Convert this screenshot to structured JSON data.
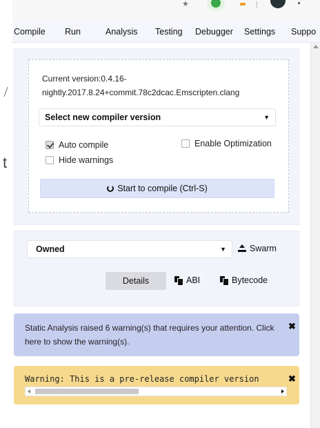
{
  "browser": {
    "icons": [
      "star-icon",
      "extension-green-icon",
      "extension-orange-icon",
      "profile-avatar",
      "menu-dots-icon"
    ]
  },
  "tabs": [
    "Compile",
    "Run",
    "Analysis",
    "Testing",
    "Debugger",
    "Settings",
    "Suppo"
  ],
  "compile": {
    "version_label": "Current version:0.4.16-nightly.2017.8.24+commit.78c2dcac.Emscripten.clang",
    "select_version": "Select new compiler version",
    "auto_compile_label": "Auto compile",
    "auto_compile_checked": true,
    "enable_optimization_label": "Enable Optimization",
    "enable_optimization_checked": false,
    "hide_warnings_label": "Hide warnings",
    "hide_warnings_checked": false,
    "compile_button": "Start to compile (Ctrl-S)"
  },
  "contract": {
    "selected": "Owned",
    "swarm_label": "Swarm",
    "details_label": "Details",
    "abi_label": "ABI",
    "bytecode_label": "Bytecode"
  },
  "alerts": {
    "analysis": "Static Analysis raised 6 warning(s) that requires your attention. Click here to show the warning(s).",
    "warning": "Warning: This is a pre-release compiler version"
  },
  "colors": {
    "panel_bg": "#f2f4fb",
    "analysis_bg": "#c6cef0",
    "warning_bg": "#f6d98d",
    "button_bg": "#dde3f8"
  }
}
